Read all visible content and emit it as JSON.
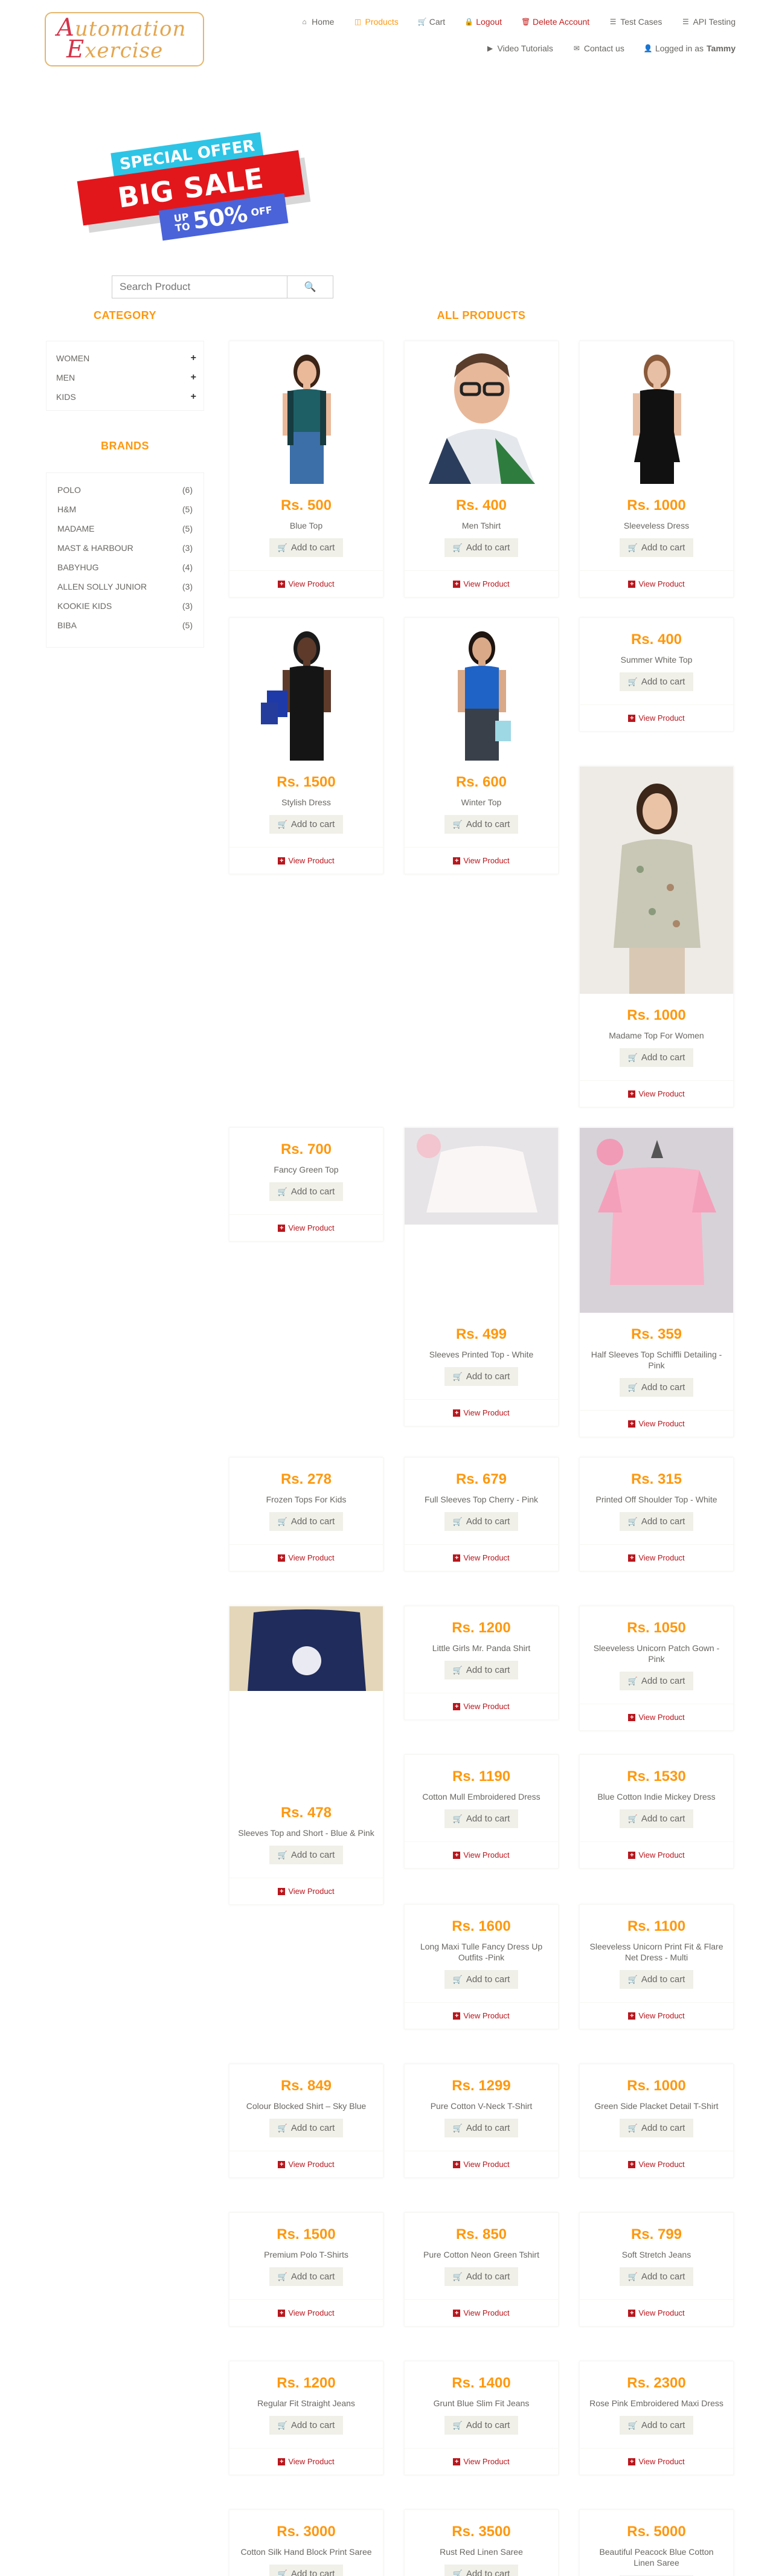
{
  "logo": {
    "line1_first": "A",
    "line1_rest": "utomation",
    "line2_first": "E",
    "line2_rest": "xercise"
  },
  "nav": {
    "home": "Home",
    "products": "Products",
    "cart": "Cart",
    "logout": "Logout",
    "delete_account": "Delete Account",
    "test_cases": "Test Cases",
    "api_testing": "API Testing",
    "video_tutorials": "Video Tutorials",
    "contact_us": "Contact us",
    "logged_in_prefix": "Logged in as",
    "username": "Tammy"
  },
  "banner": {
    "special_offer": "SPECIAL OFFER",
    "big_sale": "BIG SALE",
    "up_to": "UP",
    "to": "TO",
    "discount": "50%",
    "off": "OFF"
  },
  "search": {
    "placeholder": "Search Product"
  },
  "sidebar": {
    "category_title": "CATEGORY",
    "categories": [
      {
        "label": "WOMEN",
        "toggle": "+"
      },
      {
        "label": "MEN",
        "toggle": "+"
      },
      {
        "label": "KIDS",
        "toggle": "+"
      }
    ],
    "brands_title": "BRANDS",
    "brands": [
      {
        "label": "POLO",
        "count": "(6)"
      },
      {
        "label": "H&M",
        "count": "(5)"
      },
      {
        "label": "MADAME",
        "count": "(5)"
      },
      {
        "label": "MAST & HARBOUR",
        "count": "(3)"
      },
      {
        "label": "BABYHUG",
        "count": "(4)"
      },
      {
        "label": "ALLEN SOLLY JUNIOR",
        "count": "(3)"
      },
      {
        "label": "KOOKIE KIDS",
        "count": "(3)"
      },
      {
        "label": "BIBA",
        "count": "(5)"
      }
    ]
  },
  "products_title": "ALL PRODUCTS",
  "add_to_cart": "Add to cart",
  "view_product": "View Product",
  "products": [
    {
      "price": "Rs. 500",
      "name": "Blue Top",
      "img": "woman-teal"
    },
    {
      "price": "Rs. 400",
      "name": "Men Tshirt",
      "img": "man-glasses"
    },
    {
      "price": "Rs. 1000",
      "name": "Sleeveless Dress",
      "img": "woman-black-dress"
    },
    {
      "price": "Rs. 1500",
      "name": "Stylish Dress",
      "img": "woman-bags"
    },
    {
      "price": "Rs. 600",
      "name": "Winter Top",
      "img": "woman-blue-top"
    },
    {
      "price": "Rs. 400",
      "name": "Summer White Top",
      "img": ""
    },
    {
      "price": "Rs. 1000",
      "name": "Madame Top For Women",
      "img": "woman-floral-top"
    },
    {
      "price": "Rs. 700",
      "name": "Fancy Green Top",
      "img": ""
    },
    {
      "price": "Rs. 499",
      "name": "Sleeves Printed Top - White",
      "img": "white-frock"
    },
    {
      "price": "Rs. 359",
      "name": "Half Sleeves Top Schiffli Detailing - Pink",
      "img": "pink-top"
    },
    {
      "price": "Rs. 278",
      "name": "Frozen Tops For Kids",
      "img": ""
    },
    {
      "price": "Rs. 679",
      "name": "Full Sleeves Top Cherry - Pink",
      "img": ""
    },
    {
      "price": "Rs. 315",
      "name": "Printed Off Shoulder Top - White",
      "img": ""
    },
    {
      "price": "Rs. 478",
      "name": "Sleeves Top and Short - Blue & Pink",
      "img": "navy-top"
    },
    {
      "price": "Rs. 1200",
      "name": "Little Girls Mr. Panda Shirt",
      "img": ""
    },
    {
      "price": "Rs. 1050",
      "name": "Sleeveless Unicorn Patch Gown - Pink",
      "img": ""
    },
    {
      "price": "Rs. 1190",
      "name": "Cotton Mull Embroidered Dress",
      "img": ""
    },
    {
      "price": "Rs. 1530",
      "name": "Blue Cotton Indie Mickey Dress",
      "img": ""
    },
    {
      "price": "Rs. 1600",
      "name": "Long Maxi Tulle Fancy Dress Up Outfits -Pink",
      "img": ""
    },
    {
      "price": "Rs. 1100",
      "name": "Sleeveless Unicorn Print Fit & Flare Net Dress - Multi",
      "img": ""
    },
    {
      "price": "Rs. 849",
      "name": "Colour Blocked Shirt – Sky Blue",
      "img": ""
    },
    {
      "price": "Rs. 1299",
      "name": "Pure Cotton V-Neck T-Shirt",
      "img": ""
    },
    {
      "price": "Rs. 1000",
      "name": "Green Side Placket Detail T-Shirt",
      "img": ""
    },
    {
      "price": "Rs. 1500",
      "name": "Premium Polo T-Shirts",
      "img": ""
    },
    {
      "price": "Rs. 850",
      "name": "Pure Cotton Neon Green Tshirt",
      "img": ""
    },
    {
      "price": "Rs. 799",
      "name": "Soft Stretch Jeans",
      "img": ""
    },
    {
      "price": "Rs. 1200",
      "name": "Regular Fit Straight Jeans",
      "img": ""
    },
    {
      "price": "Rs. 1400",
      "name": "Grunt Blue Slim Fit Jeans",
      "img": ""
    },
    {
      "price": "Rs. 2300",
      "name": "Rose Pink Embroidered Maxi Dress",
      "img": ""
    },
    {
      "price": "Rs. 3000",
      "name": "Cotton Silk Hand Block Print Saree",
      "img": ""
    },
    {
      "price": "Rs. 3500",
      "name": "Rust Red Linen Saree",
      "img": ""
    },
    {
      "price": "Rs. 5000",
      "name": "Beautiful Peacock Blue Cotton Linen Saree",
      "img": ""
    }
  ]
}
